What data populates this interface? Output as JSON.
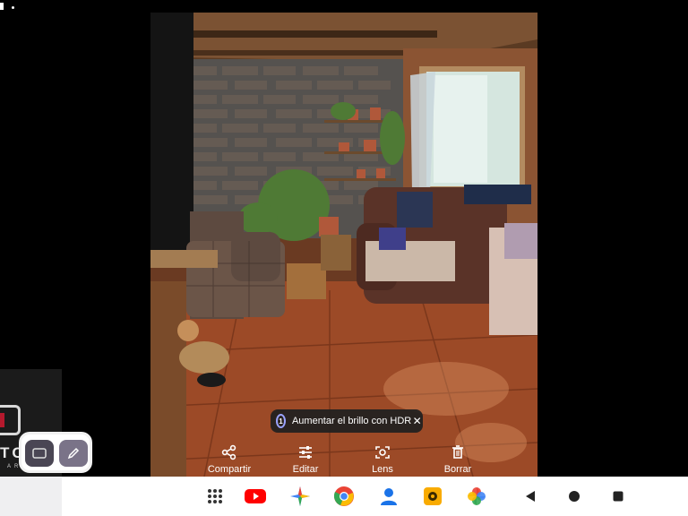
{
  "status_bar": {
    "icons": [
      "sim-icon",
      "notification-dot-icon"
    ]
  },
  "photo": {
    "description_icon": "photo-image"
  },
  "hdr_chip": {
    "badge": "1",
    "label": "Aumentar el brillo con HDR",
    "close_icon": "close-icon"
  },
  "actions": [
    {
      "label": "Compartir",
      "icon": "share-icon"
    },
    {
      "label": "Editar",
      "icon": "edit-sliders-icon"
    },
    {
      "label": "Lens",
      "icon": "lens-icon"
    },
    {
      "label": "Borrar",
      "icon": "trash-icon"
    }
  ],
  "widget": {
    "brand": "TCH",
    "sub": "ARIO",
    "left_button_icon": "pip-icon",
    "right_button_icon": "pencil-icon"
  },
  "taskbar": {
    "apps": [
      "app-drawer-icon",
      "youtube-icon",
      "spark-app-icon",
      "chrome-icon",
      "contacts-icon",
      "app-icon-yellow",
      "photos-icon"
    ],
    "nav": [
      "back-icon",
      "home-icon",
      "recents-icon"
    ]
  },
  "colors": {
    "taskbar_bg": "#ffffff",
    "chip_bg": "#202020",
    "accent_blue": "#1a73e8"
  }
}
